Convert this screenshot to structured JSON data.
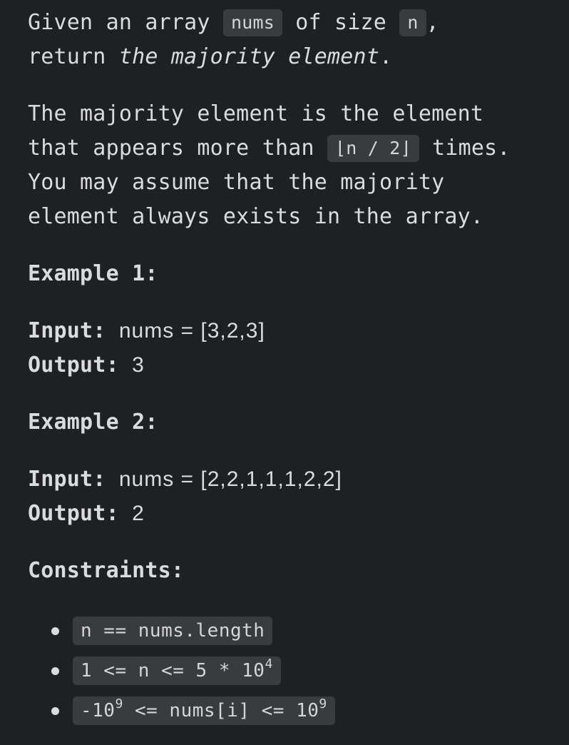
{
  "intro": {
    "t1": "Given an array ",
    "code1": "nums",
    "t2": " of size ",
    "code2": "n",
    "t3": ",",
    "t4": "return ",
    "em": "the majority element",
    "t5": "."
  },
  "description": {
    "t1": "The majority element is the element",
    "t2": "that appears more than ",
    "code": "⌊n / 2⌋",
    "t3": " times.",
    "t4": "You may assume that the majority",
    "t5": "element always exists in the array."
  },
  "example1": {
    "heading": "Example 1:",
    "input_label": "Input:",
    "input_value": "nums = [3,2,3]",
    "output_label": "Output:",
    "output_value": "3"
  },
  "example2": {
    "heading": "Example 2:",
    "input_label": "Input:",
    "input_value": "nums = [2,2,1,1,1,2,2]",
    "output_label": "Output:",
    "output_value": "2"
  },
  "constraints": {
    "heading": "Constraints:",
    "items": [
      {
        "text": "n == nums.length"
      },
      {
        "pre": "1 <= n <= 5 * 10",
        "sup": "4"
      },
      {
        "pre": "-10",
        "sup1": "9",
        "mid": " <= nums[i] <= 10",
        "sup2": "9"
      }
    ]
  }
}
